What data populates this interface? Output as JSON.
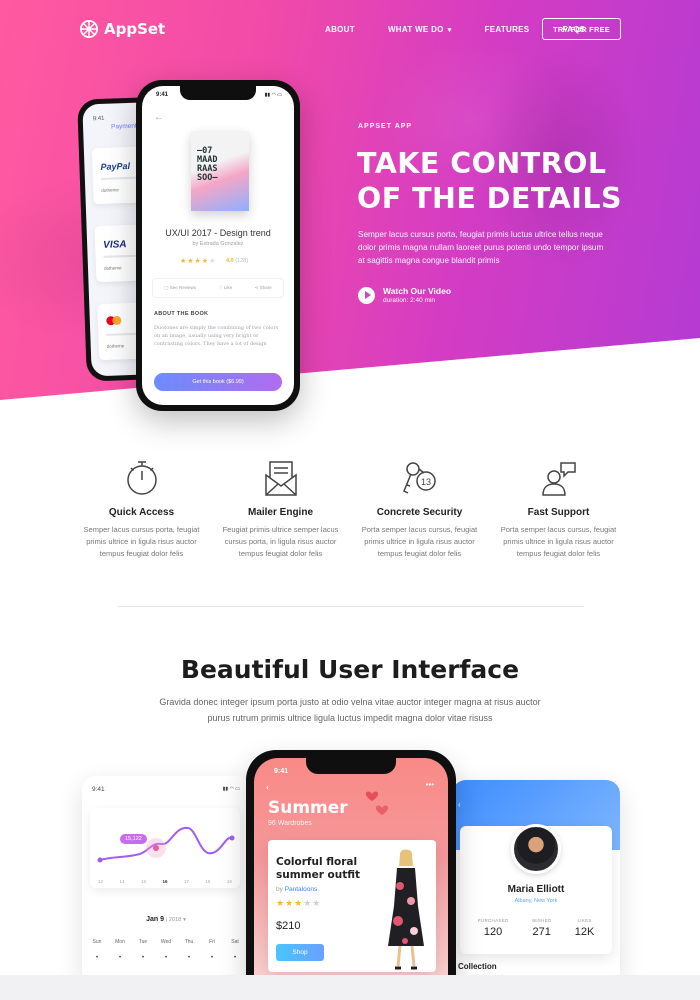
{
  "brand": {
    "name": "AppSet"
  },
  "nav": {
    "items": [
      "ABOUT",
      "WHAT WE DO",
      "FEATURES",
      "FAQS"
    ],
    "cta": "TRY FOR FREE"
  },
  "hero": {
    "eyebrow": "APPSET APP",
    "title_line1": "TAKE CONTROL",
    "title_line2": "OF THE DETAILS",
    "description": "Semper lacus cursus porta, feugiat primis luctus ultrice tellus neque dolor primis magna nullam laoreet purus potenti undo tempor ipsum at sagittis magna congue blandit primis",
    "video_title": "Watch Our Video",
    "video_duration": "duration: 2:40 min"
  },
  "hero_phone_back": {
    "time": "9:41",
    "title": "Payment m",
    "cards": [
      {
        "label": "PayPal",
        "sub": "dotheme"
      },
      {
        "label": "VISA",
        "sub": "dotheme"
      },
      {
        "label": "",
        "sub": "dotheme"
      }
    ]
  },
  "hero_phone_main": {
    "time": "9:41",
    "book_cover": [
      "—07",
      "MAAD",
      "RAAS",
      "SOO—"
    ],
    "book_title": "UX/UI 2017 - Design trend",
    "book_author": "by Estrada Gonzalez",
    "rating": "4.0",
    "rating_count": "(128)",
    "actions": [
      "See Reviews",
      "Like",
      "Share"
    ],
    "about_heading": "ABOUT THE BOOK",
    "about_text": "Duotones are simply the combining of two colors on an image, usually using very bright or contrasting colors. They have a lot of design",
    "buy_label": "Get this book ($6.99)"
  },
  "features": [
    {
      "icon": "stopwatch-icon",
      "title": "Quick Access",
      "text": "Semper lacus cursus porta, feugiat primis ultrice in ligula risus auctor tempus feugiat dolor felis"
    },
    {
      "icon": "mail-icon",
      "title": "Mailer Engine",
      "text": "Feugiat primis ultrice semper lacus cursus porta, in ligula risus auctor tempus feugiat dolor felis"
    },
    {
      "icon": "keys-icon",
      "title": "Concrete Security",
      "text": "Porta semper lacus cursus, feugiat primis ultrice in ligula risus auctor tempus feugiat dolor felis"
    },
    {
      "icon": "support-icon",
      "title": "Fast Support",
      "text": "Porta semper lacus cursus, feugiat primis ultrice in ligula risus auctor tempus feugiat dolor felis"
    }
  ],
  "interface": {
    "title": "Beautiful User Interface",
    "description": "Gravida donec integer ipsum porta justo at odio velna vitae auctor integer magna at risus auctor purus rutrum primis ultrice ligula luctus impedit magna dolor vitae risuss"
  },
  "left_phone": {
    "time": "9:41",
    "chart_value": "15,122",
    "chart_ticks": [
      "13",
      "14",
      "15",
      "16",
      "17",
      "18",
      "19"
    ],
    "month": "Jan 9",
    "year": "2018",
    "weekdays": [
      "Sun",
      "Mon",
      "Tue",
      "Wed",
      "Thu",
      "Fri",
      "Sat"
    ]
  },
  "center_phone": {
    "time": "9:41",
    "title": "Summer",
    "subtitle": "96 Wardrobes",
    "product_title": "Colorful floral summer outfit",
    "by_prefix": "by",
    "brand": "Pantaloons",
    "price": "$210",
    "shop_label": "Shop"
  },
  "right_phone": {
    "name": "Maria Elliott",
    "location": "Albany, New York",
    "stats": [
      {
        "label": "PURCHASED",
        "value": "120"
      },
      {
        "label": "WISHED",
        "value": "271"
      },
      {
        "label": "LIKES",
        "value": "12K"
      }
    ],
    "section": "Collection"
  },
  "colors": {
    "hero_gradient_start": "#ff5aa0",
    "hero_gradient_end": "#b43bd3",
    "accent_blue": "#2e88ff",
    "star": "#f7b731"
  }
}
